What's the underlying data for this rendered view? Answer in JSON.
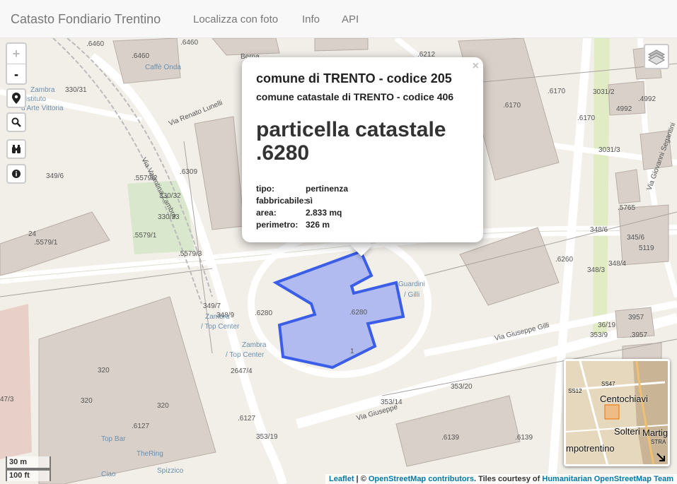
{
  "navbar": {
    "brand": "Catasto Fondiario Trentino",
    "links": [
      "Localizza con foto",
      "Info",
      "API"
    ]
  },
  "controls": {
    "zoom_in": "+",
    "zoom_out": "-"
  },
  "popup": {
    "close": "×",
    "comune": "comune di TRENTO - codice 205",
    "comune_catastale": "comune catastale di TRENTO - codice 406",
    "title_prefix": "particella catastale",
    "parcel": ".6280",
    "attributes": [
      {
        "key": "tipo:",
        "value": "pertinenza"
      },
      {
        "key": "fabbricabile:",
        "value": "sì"
      },
      {
        "key": "area:",
        "value": "2.833 mq"
      },
      {
        "key": "perimetro:",
        "value": "326 m"
      }
    ]
  },
  "map_labels": {
    "parcels": [
      ".6460",
      ".6460",
      ".6460",
      "330/31",
      "349/6",
      ".5579/2",
      "330/32",
      "330/33",
      ".5579/1",
      ".5579/3",
      ".5579/1",
      ".6309",
      ".6280",
      ".6280",
      "348/9",
      "349/7",
      "2647/4",
      ".6127",
      ".6127",
      "353/19",
      "353/14",
      "353/20",
      ".6139",
      ".6139",
      ".6260",
      ".6170",
      ".6170",
      ".6212",
      "3031/2",
      ".4992",
      ".4992",
      "3031/3",
      ".5765",
      "348/6",
      "345/6",
      "348/4",
      "348/3",
      "5119",
      "3957",
      ".3957",
      "353/9",
      "36/19",
      "47/3",
      "1",
      "320",
      "320",
      "320",
      "24"
    ],
    "streets": [
      "Via Renato Lunelli",
      "Via Giuseppe Gilli",
      "Via Giuseppe",
      "Via Valentina Zambra",
      "Via Giovanni Segantini"
    ],
    "pois": [
      "Zambra / Istituto d'Arte Vittoria",
      "Caffè Onda",
      "Zambra / Top Center",
      "Zambra / Top Center",
      "Guardini / Gilli",
      "Top Bar",
      "TheRing",
      "Spizzico",
      "Ciao",
      "Berna"
    ]
  },
  "minimap": {
    "labels": [
      "Centochiavi",
      "Solteri",
      "Martig",
      "mpotrentino",
      "SS47",
      "SS12",
      "STRA"
    ]
  },
  "scale": {
    "metric": "30 m",
    "imperial": "100 ft"
  },
  "attribution": {
    "leaflet": "Leaflet",
    "sep": " | © ",
    "osm": "OpenStreetMap contributors",
    "tiles": ". Tiles courtesy of ",
    "hot": "Humanitarian OpenStreetMap Team"
  },
  "colors": {
    "parcel_fill": "#9ba9f0",
    "parcel_stroke": "#3b5ee8",
    "building": "#d9d0c9",
    "green": "#d8e8c8",
    "road": "#ffffff"
  }
}
